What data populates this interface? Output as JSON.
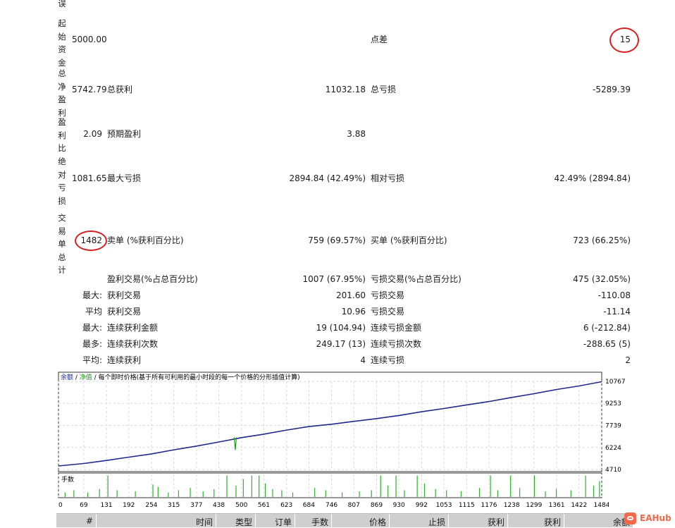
{
  "vertical_labels": {
    "cut_top": "误",
    "initial_deposit": "起始资金",
    "total_net_profit": "总净盈利",
    "profit_factor": "盈利比",
    "absolute_drawdown": "绝对亏损",
    "total_trades": "交易单总计"
  },
  "summary": {
    "initial_deposit": "5000.00",
    "spread_label": "点差",
    "spread_value": "15",
    "net_profit": "5742.79",
    "gross_profit_label": "总获利",
    "gross_profit_value": "11032.18",
    "gross_loss_label": "总亏损",
    "gross_loss_value": "-5289.39",
    "profit_factor": "2.09",
    "expected_payoff_label": "预期盈利",
    "expected_payoff_value": "3.88",
    "absolute_drawdown": "1081.65",
    "max_drawdown_label": "最大亏损",
    "max_drawdown_value": "2894.84 (42.49%)",
    "relative_drawdown_label": "相对亏损",
    "relative_drawdown_value": "42.49% (2894.84)",
    "total_trades": "1482",
    "short_label": "卖单 (%获利百分比)",
    "short_value": "759 (69.57%)",
    "long_label": "买单 (%获利百分比)",
    "long_value": "723 (66.25%)",
    "profit_trades_label": "盈利交易(%占总百分比)",
    "profit_trades_value": "1007 (67.95%)",
    "loss_trades_label": "亏损交易(%占总百分比)",
    "loss_trades_value": "475 (32.05%)"
  },
  "stats_rows": [
    {
      "prefix": "最大:",
      "left_label": "获利交易",
      "left_value": "201.60",
      "right_label": "亏损交易",
      "right_value": "-110.08"
    },
    {
      "prefix": "平均",
      "left_label": "获利交易",
      "left_value": "10.96",
      "right_label": "亏损交易",
      "right_value": "-11.14"
    },
    {
      "prefix": "最大:",
      "left_label": "连续获利金额",
      "left_value": "19 (104.94)",
      "right_label": "连续亏损金额",
      "right_value": "6 (-212.84)"
    },
    {
      "prefix": "最多:",
      "left_label": "连续获利次数",
      "left_value": "249.17 (13)",
      "right_label": "连续亏损次数",
      "right_value": "-288.65 (5)"
    },
    {
      "prefix": "平均:",
      "left_label": "连续获利",
      "left_value": "4",
      "right_label": "连续亏损",
      "right_value": "2"
    }
  ],
  "chart_data": {
    "type": "line",
    "legend": {
      "balance": "余额",
      "sep1": " / ",
      "equity": "净值",
      "sep2": " / ",
      "model": "每个即时价格(基于所有可利用的最小时段的每一个价格的分形插值计算)"
    },
    "lot_label": "手数",
    "y_ticks": [
      "10767",
      "9253",
      "7739",
      "6224",
      "4710"
    ],
    "y_tick_values": [
      10767,
      9253,
      7739,
      6224,
      4710
    ],
    "x_ticks": [
      "0",
      "69",
      "131",
      "192",
      "254",
      "315",
      "377",
      "438",
      "500",
      "561",
      "623",
      "684",
      "746",
      "807",
      "869",
      "930",
      "992",
      "1053",
      "1115",
      "1176",
      "1238",
      "1299",
      "1361",
      "1422",
      "1484"
    ],
    "x_tick_values": [
      0,
      69,
      131,
      192,
      254,
      315,
      377,
      438,
      500,
      561,
      623,
      684,
      746,
      807,
      869,
      930,
      992,
      1053,
      1115,
      1176,
      1238,
      1299,
      1361,
      1422,
      1484
    ],
    "ylim": [
      4710,
      10767
    ],
    "xlim": [
      0,
      1484
    ],
    "series": [
      {
        "key": "balance",
        "color": "#1f2a8a",
        "x": [
          0,
          69,
          131,
          192,
          254,
          315,
          377,
          438,
          500,
          561,
          623,
          684,
          746,
          807,
          869,
          930,
          992,
          1053,
          1115,
          1176,
          1238,
          1299,
          1361,
          1422,
          1484
        ],
        "y": [
          4950,
          5120,
          5330,
          5560,
          5780,
          6060,
          6320,
          6600,
          6900,
          7140,
          7420,
          7660,
          7820,
          8020,
          8210,
          8420,
          8680,
          8900,
          9150,
          9380,
          9660,
          9920,
          10210,
          10450,
          10742
        ]
      },
      {
        "key": "equity",
        "color": "#1a9a1a",
        "x": [
          480,
          483,
          486
        ],
        "y": [
          6920,
          6050,
          6920
        ]
      }
    ],
    "lot_color": "#2db12d",
    "lots": [
      {
        "x": 18,
        "v": 0.2
      },
      {
        "x": 42,
        "v": 0.3
      },
      {
        "x": 80,
        "v": 0.2
      },
      {
        "x": 112,
        "v": 0.35
      },
      {
        "x": 135,
        "v": 0.95
      },
      {
        "x": 160,
        "v": 0.3
      },
      {
        "x": 210,
        "v": 0.25
      },
      {
        "x": 258,
        "v": 0.55
      },
      {
        "x": 272,
        "v": 0.45
      },
      {
        "x": 300,
        "v": 0.2
      },
      {
        "x": 328,
        "v": 0.3
      },
      {
        "x": 360,
        "v": 0.4
      },
      {
        "x": 395,
        "v": 0.25
      },
      {
        "x": 425,
        "v": 0.35
      },
      {
        "x": 460,
        "v": 0.95
      },
      {
        "x": 485,
        "v": 0.5
      },
      {
        "x": 505,
        "v": 0.8
      },
      {
        "x": 528,
        "v": 0.95
      },
      {
        "x": 548,
        "v": 0.95
      },
      {
        "x": 565,
        "v": 0.6
      },
      {
        "x": 585,
        "v": 0.35
      },
      {
        "x": 610,
        "v": 0.3
      },
      {
        "x": 640,
        "v": 0.2
      },
      {
        "x": 700,
        "v": 0.4
      },
      {
        "x": 730,
        "v": 0.3
      },
      {
        "x": 775,
        "v": 0.2
      },
      {
        "x": 822,
        "v": 0.25
      },
      {
        "x": 855,
        "v": 0.3
      },
      {
        "x": 880,
        "v": 0.95
      },
      {
        "x": 900,
        "v": 0.5
      },
      {
        "x": 922,
        "v": 0.95
      },
      {
        "x": 945,
        "v": 0.3
      },
      {
        "x": 980,
        "v": 0.95
      },
      {
        "x": 1000,
        "v": 0.6
      },
      {
        "x": 1030,
        "v": 0.35
      },
      {
        "x": 1060,
        "v": 0.3
      },
      {
        "x": 1100,
        "v": 0.25
      },
      {
        "x": 1150,
        "v": 0.4
      },
      {
        "x": 1180,
        "v": 0.95
      },
      {
        "x": 1200,
        "v": 0.3
      },
      {
        "x": 1235,
        "v": 0.95
      },
      {
        "x": 1260,
        "v": 0.4
      },
      {
        "x": 1300,
        "v": 0.95
      },
      {
        "x": 1330,
        "v": 0.25
      },
      {
        "x": 1360,
        "v": 0.35
      },
      {
        "x": 1400,
        "v": 0.3
      },
      {
        "x": 1440,
        "v": 0.95
      },
      {
        "x": 1462,
        "v": 0.5
      },
      {
        "x": 1478,
        "v": 0.7
      }
    ]
  },
  "table_header": [
    "#",
    "时间",
    "类型",
    "订单",
    "手数",
    "价格",
    "止损",
    "获利",
    "获利",
    "余额"
  ],
  "logo": {
    "text": "EAHub"
  }
}
